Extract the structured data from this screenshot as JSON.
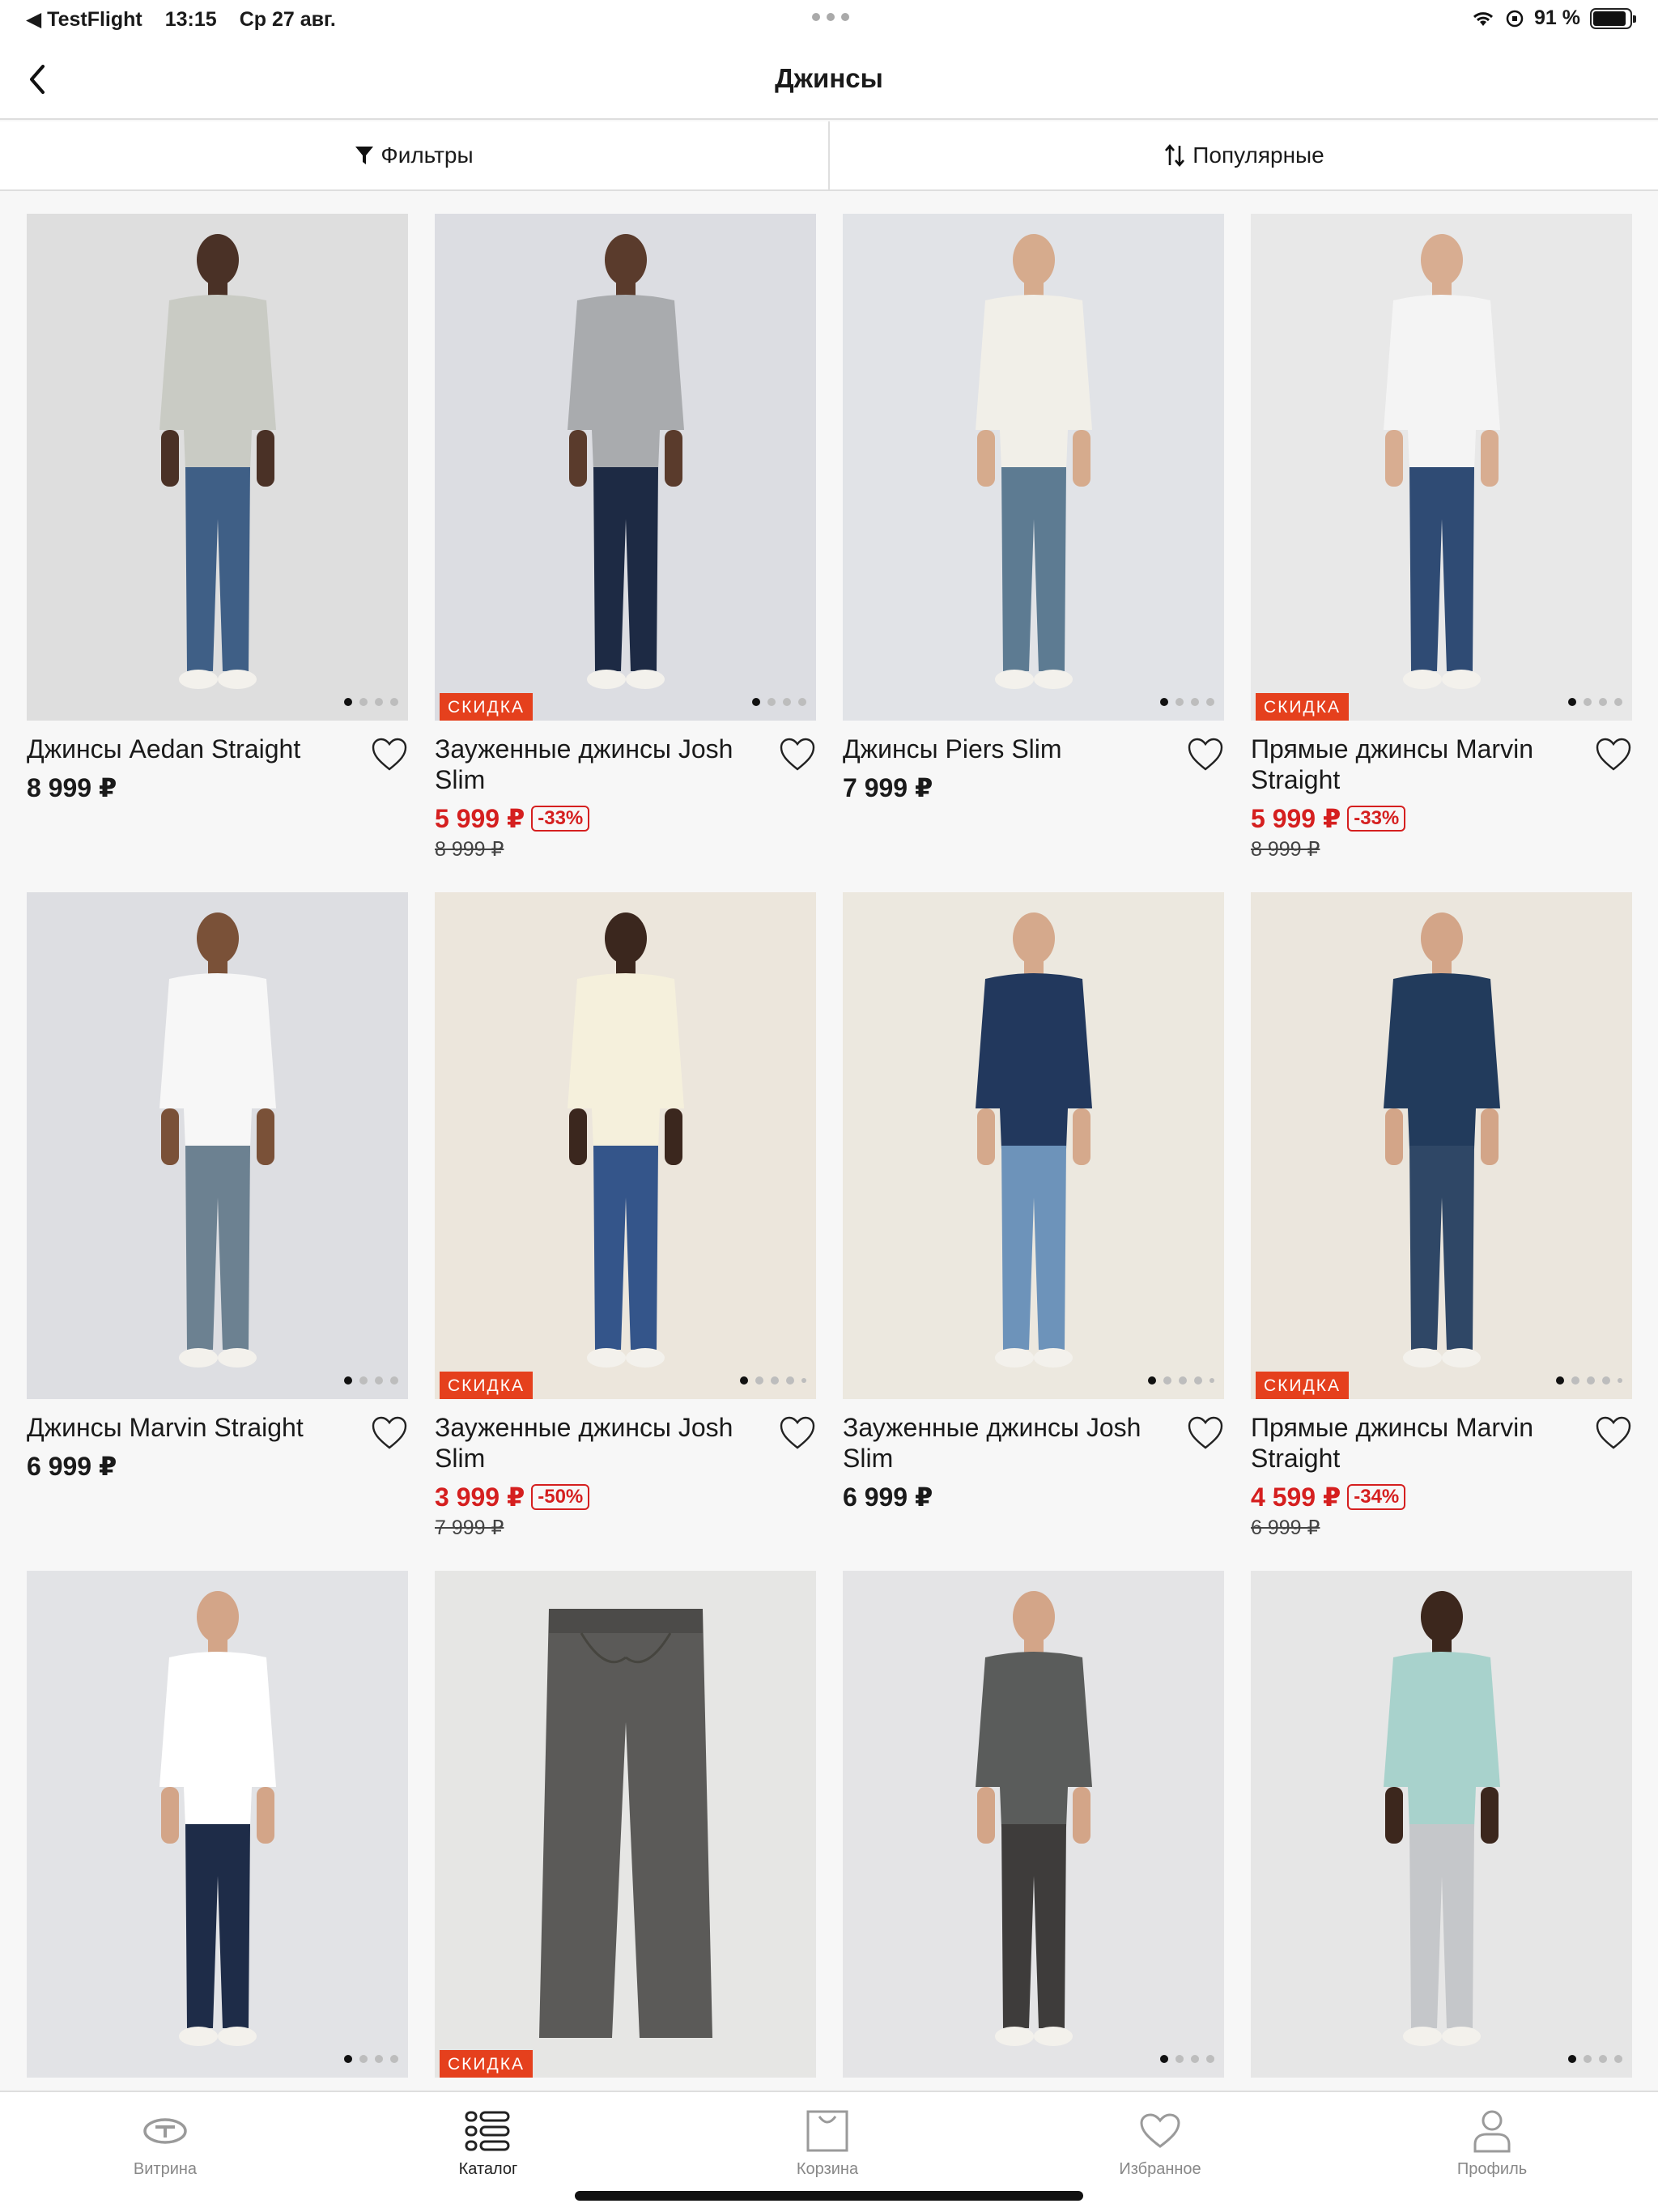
{
  "status_bar": {
    "back_app": "◀ TestFlight",
    "time": "13:15",
    "date": "Ср 27 авг.",
    "battery": "91 %",
    "battery_level": 0.91
  },
  "nav": {
    "title": "Джинсы",
    "back_icon": "chevron-left-icon"
  },
  "filter_bar": {
    "filters_label": "Фильтры",
    "sort_label": "Популярные"
  },
  "badge_text": "СКИДКА",
  "products": [
    {
      "name": "Джинсы Aedan Straight",
      "price": "8 999 ₽",
      "sale": false,
      "bg": "#dedede",
      "shirt": "#c9cbc4",
      "pants": "#3f5f86",
      "skin": "#4a3126",
      "dots": 4
    },
    {
      "name": "Зауженные джинсы Josh Slim",
      "price": "5 999 ₽",
      "discount": "-33%",
      "old_price": "8 999 ₽",
      "sale": true,
      "bg": "#dcdde2",
      "shirt": "#a9abae",
      "pants": "#1d2a44",
      "skin": "#5a3b2c",
      "dots": 4
    },
    {
      "name": "Джинсы Piers Slim",
      "price": "7 999 ₽",
      "sale": false,
      "bg": "#e1e3e7",
      "shirt": "#f1efe8",
      "pants": "#5d7b92",
      "skin": "#d6ab8d",
      "dots": 4
    },
    {
      "name": "Прямые джинсы Marvin Straight",
      "price": "5 999 ₽",
      "discount": "-33%",
      "old_price": "8 999 ₽",
      "sale": true,
      "bg": "#e8e8e8",
      "shirt": "#f4f4f4",
      "pants": "#2f4b74",
      "skin": "#d8ad91",
      "dots": 4
    },
    {
      "name": "Джинсы Marvin Straight",
      "price": "6 999 ₽",
      "sale": false,
      "bg": "#dddee2",
      "shirt": "#f7f7f7",
      "pants": "#6c8191",
      "skin": "#7a5138",
      "dots": 4
    },
    {
      "name": "Зауженные джинсы Josh Slim",
      "price": "3 999 ₽",
      "discount": "-50%",
      "old_price": "7 999 ₽",
      "sale": true,
      "bg": "#ece6dc",
      "shirt": "#f5f0dc",
      "pants": "#34558a",
      "skin": "#3b271e",
      "dots": 5
    },
    {
      "name": "Зауженные джинсы Josh Slim",
      "price": "6 999 ₽",
      "sale": false,
      "bg": "#ece8df",
      "shirt": "#22385d",
      "pants": "#6d93ba",
      "skin": "#d5a98c",
      "dots": 5
    },
    {
      "name": "Прямые джинсы Marvin Straight",
      "price": "4 599 ₽",
      "discount": "-34%",
      "old_price": "6 999 ₽",
      "sale": true,
      "bg": "#ebe6dd",
      "shirt": "#223b5c",
      "pants": "#2f4766",
      "skin": "#d3a588",
      "dots": 5
    },
    {
      "name": "",
      "price": "",
      "sale": false,
      "bg": "#e2e3e6",
      "shirt": "#ffffff",
      "pants": "#1e2c48",
      "skin": "#d3a588",
      "dots": 4
    },
    {
      "name": "",
      "price": "",
      "sale": true,
      "bg": "#e6e6e4",
      "shirt": "none",
      "pants": "#5b5a58",
      "skin": "none",
      "dots": 0
    },
    {
      "name": "",
      "price": "",
      "sale": false,
      "bg": "#e4e4e6",
      "shirt": "#5a5c5b",
      "pants": "#3e3c3b",
      "skin": "#d3a588",
      "dots": 4
    },
    {
      "name": "",
      "price": "",
      "sale": false,
      "bg": "#e6e6e6",
      "shirt": "#a8d2cc",
      "pants": "#c5c7ca",
      "skin": "#3c271d",
      "dots": 4
    }
  ],
  "tab_bar": [
    {
      "label": "Витрина",
      "icon": "brand-logo-icon",
      "active": false
    },
    {
      "label": "Каталог",
      "icon": "catalog-list-icon",
      "active": true
    },
    {
      "label": "Корзина",
      "icon": "shopping-bag-icon",
      "active": false
    },
    {
      "label": "Избранное",
      "icon": "heart-icon",
      "active": false
    },
    {
      "label": "Профиль",
      "icon": "profile-icon",
      "active": false
    }
  ]
}
